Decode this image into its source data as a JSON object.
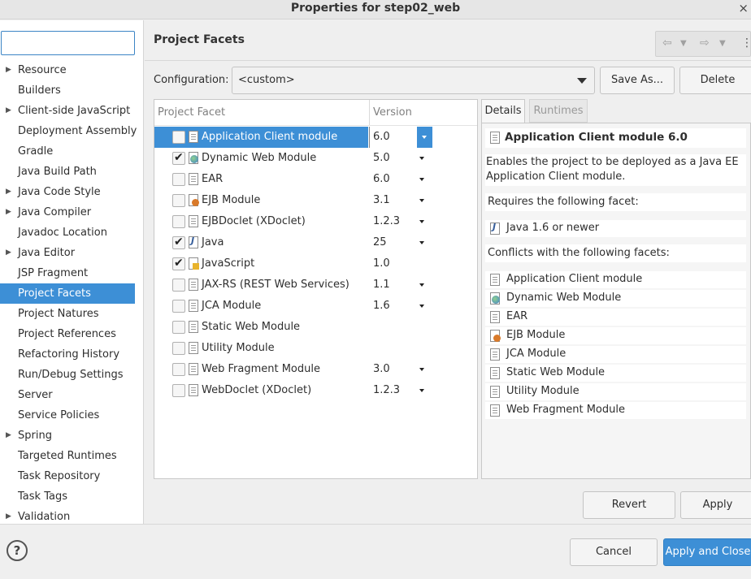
{
  "window": {
    "title": "Properties for step02_web",
    "close_glyph": "×"
  },
  "sidebar": {
    "filter_value": "",
    "items": [
      {
        "label": "Resource",
        "expandable": true
      },
      {
        "label": "Builders",
        "expandable": false
      },
      {
        "label": "Client-side JavaScript",
        "expandable": true
      },
      {
        "label": "Deployment Assembly",
        "expandable": false
      },
      {
        "label": "Gradle",
        "expandable": false
      },
      {
        "label": "Java Build Path",
        "expandable": false
      },
      {
        "label": "Java Code Style",
        "expandable": true
      },
      {
        "label": "Java Compiler",
        "expandable": true
      },
      {
        "label": "Javadoc Location",
        "expandable": false
      },
      {
        "label": "Java Editor",
        "expandable": true
      },
      {
        "label": "JSP Fragment",
        "expandable": false
      },
      {
        "label": "Project Facets",
        "expandable": false,
        "selected": true
      },
      {
        "label": "Project Natures",
        "expandable": false
      },
      {
        "label": "Project References",
        "expandable": false
      },
      {
        "label": "Refactoring History",
        "expandable": false
      },
      {
        "label": "Run/Debug Settings",
        "expandable": false
      },
      {
        "label": "Server",
        "expandable": false
      },
      {
        "label": "Service Policies",
        "expandable": false
      },
      {
        "label": "Spring",
        "expandable": true
      },
      {
        "label": "Targeted Runtimes",
        "expandable": false
      },
      {
        "label": "Task Repository",
        "expandable": false
      },
      {
        "label": "Task Tags",
        "expandable": false
      },
      {
        "label": "Validation",
        "expandable": true
      }
    ]
  },
  "main": {
    "heading": "Project Facets",
    "toolbar": {
      "back_icon": "back-arrow-icon",
      "forward_icon": "forward-arrow-icon",
      "menu_icon": "view-menu-icon"
    },
    "configuration": {
      "label": "Configuration:",
      "value": "<custom>",
      "save_as_label": "Save As...",
      "delete_label": "Delete"
    },
    "facets_table": {
      "col_facet": "Project Facet",
      "col_version": "Version",
      "rows": [
        {
          "name": "Application Client module",
          "version": "6.0",
          "checked": false,
          "icon": "page",
          "has_dropdown": true,
          "selected": true
        },
        {
          "name": "Dynamic Web Module",
          "version": "5.0",
          "checked": true,
          "icon": "web",
          "has_dropdown": true
        },
        {
          "name": "EAR",
          "version": "6.0",
          "checked": false,
          "icon": "page",
          "has_dropdown": true
        },
        {
          "name": "EJB Module",
          "version": "3.1",
          "checked": false,
          "icon": "ejb",
          "has_dropdown": true
        },
        {
          "name": "EJBDoclet (XDoclet)",
          "version": "1.2.3",
          "checked": false,
          "icon": "page",
          "has_dropdown": true
        },
        {
          "name": "Java",
          "version": "25",
          "checked": true,
          "icon": "java",
          "has_dropdown": true
        },
        {
          "name": "JavaScript",
          "version": "1.0",
          "checked": true,
          "icon": "js",
          "has_dropdown": false
        },
        {
          "name": "JAX-RS (REST Web Services)",
          "version": "1.1",
          "checked": false,
          "icon": "page",
          "has_dropdown": true
        },
        {
          "name": "JCA Module",
          "version": "1.6",
          "checked": false,
          "icon": "page",
          "has_dropdown": true
        },
        {
          "name": "Static Web Module",
          "version": "",
          "checked": false,
          "icon": "page",
          "has_dropdown": false
        },
        {
          "name": "Utility Module",
          "version": "",
          "checked": false,
          "icon": "page",
          "has_dropdown": false
        },
        {
          "name": "Web Fragment Module",
          "version": "3.0",
          "checked": false,
          "icon": "page",
          "has_dropdown": true
        },
        {
          "name": "WebDoclet (XDoclet)",
          "version": "1.2.3",
          "checked": false,
          "icon": "page",
          "has_dropdown": true
        }
      ]
    },
    "details": {
      "tab_details": "Details",
      "tab_runtimes": "Runtimes",
      "title": "Application Client module 6.0",
      "description_line1": "Enables the project to be deployed as a Java EE",
      "description_line2": "Application Client module.",
      "requires_heading": "Requires the following facet:",
      "requires": [
        {
          "label": "Java 1.6 or newer",
          "icon": "java"
        }
      ],
      "conflicts_heading": "Conflicts with the following facets:",
      "conflicts": [
        {
          "label": "Application Client module",
          "icon": "page"
        },
        {
          "label": "Dynamic Web Module",
          "icon": "web"
        },
        {
          "label": "EAR",
          "icon": "page"
        },
        {
          "label": "EJB Module",
          "icon": "ejb"
        },
        {
          "label": "JCA Module",
          "icon": "page"
        },
        {
          "label": "Static Web Module",
          "icon": "page"
        },
        {
          "label": "Utility Module",
          "icon": "page"
        },
        {
          "label": "Web Fragment Module",
          "icon": "page"
        }
      ]
    },
    "revert_label": "Revert",
    "apply_label": "Apply"
  },
  "footer": {
    "help_glyph": "?",
    "cancel_label": "Cancel",
    "apply_close_label": "Apply and Close"
  },
  "colors": {
    "accent": "#3d8fd6",
    "background": "#efefef"
  }
}
